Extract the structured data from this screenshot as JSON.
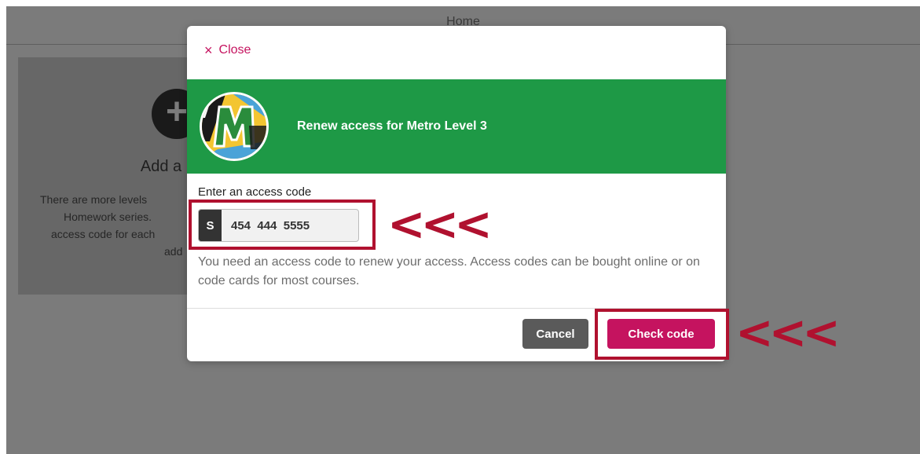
{
  "background": {
    "header_title": "Home",
    "add_card": {
      "icon": "plus-icon",
      "title": "Add a",
      "description_lines": [
        "There are more levels",
        "Homework series.",
        "access code for each",
        "add"
      ]
    }
  },
  "modal": {
    "close_label": "Close",
    "close_icon": "×",
    "banner": {
      "title": "Renew access for Metro Level 3",
      "color": "#1e9946",
      "logo_icon": "metro-logo-icon"
    },
    "code_label": "Enter an access code",
    "code_prefix": "S",
    "code_value": "454  444  5555",
    "help_text": "You need an access code to renew your access. Access codes can be bought online or on code cards for most courses.",
    "cancel_label": "Cancel",
    "check_label": "Check code",
    "accent_color": "#c5135f"
  },
  "annotations": {
    "arrow_text": "<<<",
    "color": "#b0112f"
  }
}
